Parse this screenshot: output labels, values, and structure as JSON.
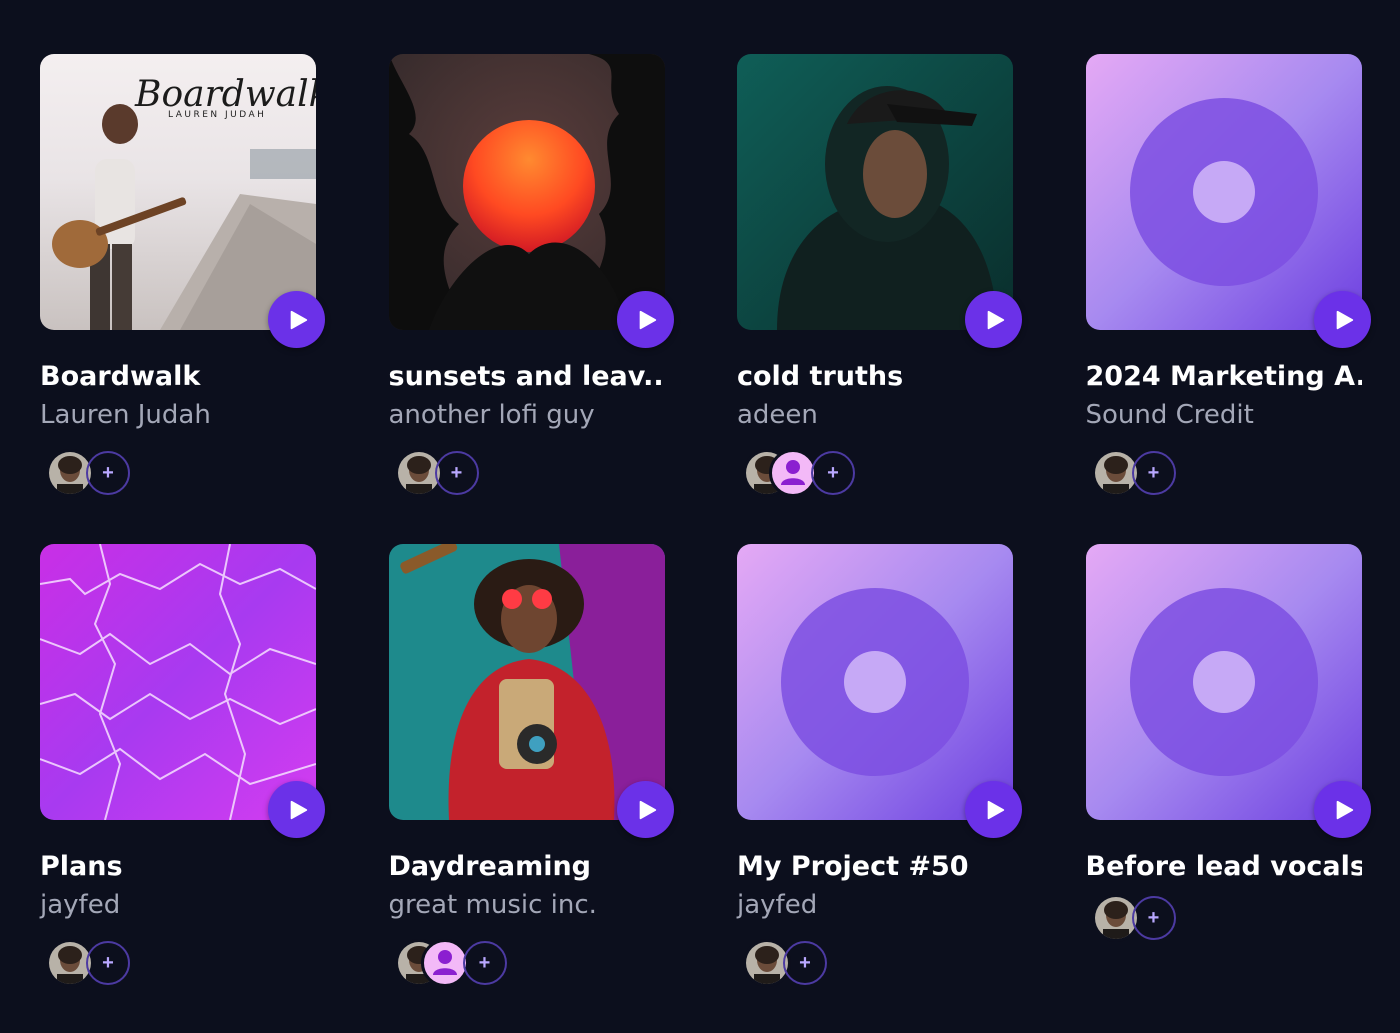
{
  "play_icon": "play-icon",
  "add_icon": "plus-icon",
  "colors": {
    "background": "#0c0f1d",
    "accent": "#6b31e8",
    "title": "#ffffff",
    "artist": "#a3a7b7"
  },
  "projects": [
    {
      "title": "Boardwalk",
      "artist": "Lauren Judah",
      "cover_text": {
        "script": "Boardwalk",
        "sub": "LAUREN JUDAH"
      }
    },
    {
      "title": "sunsets and leav...",
      "artist": "another lofi guy"
    },
    {
      "title": "cold truths",
      "artist": "adeen"
    },
    {
      "title": "2024 Marketing A...",
      "artist": "Sound Credit"
    },
    {
      "title": "Plans",
      "artist": "jayfed"
    },
    {
      "title": "Daydreaming",
      "artist": "great music inc."
    },
    {
      "title": "My Project #50",
      "artist": "jayfed"
    },
    {
      "title": "Before lead vocals",
      "artist": ""
    }
  ]
}
